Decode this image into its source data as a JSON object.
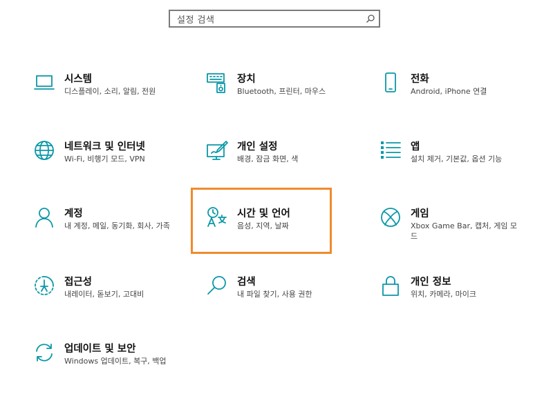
{
  "search": {
    "placeholder": "설정 검색",
    "icon": "search-icon"
  },
  "colors": {
    "accent": "#0a97a8",
    "highlight": "#f08a2c"
  },
  "tiles": [
    {
      "id": "system",
      "title": "시스템",
      "desc": "디스플레이, 소리, 알림, 전원",
      "icon": "laptop-icon"
    },
    {
      "id": "devices",
      "title": "장치",
      "desc": "Bluetooth, 프린터, 마우스",
      "icon": "keyboard-speaker-icon"
    },
    {
      "id": "phone",
      "title": "전화",
      "desc": "Android, iPhone 연결",
      "icon": "phone-icon"
    },
    {
      "id": "network",
      "title": "네트워크 및 인터넷",
      "desc": "Wi-Fi, 비행기 모드, VPN",
      "icon": "globe-icon"
    },
    {
      "id": "personalization",
      "title": "개인 설정",
      "desc": "배경, 잠금 화면, 색",
      "icon": "paint-screen-icon"
    },
    {
      "id": "apps",
      "title": "앱",
      "desc": "설치 제거, 기본값, 옵션 기능",
      "icon": "app-list-icon"
    },
    {
      "id": "accounts",
      "title": "계정",
      "desc": "내 계정, 메일, 동기화, 회사, 가족",
      "icon": "person-icon"
    },
    {
      "id": "time-language",
      "title": "시간 및 언어",
      "desc": "음성, 지역, 날짜",
      "icon": "time-language-icon"
    },
    {
      "id": "gaming",
      "title": "게임",
      "desc": "Xbox Game Bar, 캡처, 게임 모드",
      "icon": "xbox-icon"
    },
    {
      "id": "accessibility",
      "title": "접근성",
      "desc": "내레이터, 돋보기, 고대비",
      "icon": "ease-of-access-icon"
    },
    {
      "id": "search",
      "title": "검색",
      "desc": "내 파일 찾기, 사용 권한",
      "icon": "magnifier-icon"
    },
    {
      "id": "privacy",
      "title": "개인 정보",
      "desc": "위치, 카메라, 마이크",
      "icon": "lock-icon"
    },
    {
      "id": "update",
      "title": "업데이트 및 보안",
      "desc": "Windows 업데이트, 복구, 백업",
      "icon": "sync-icon"
    }
  ]
}
